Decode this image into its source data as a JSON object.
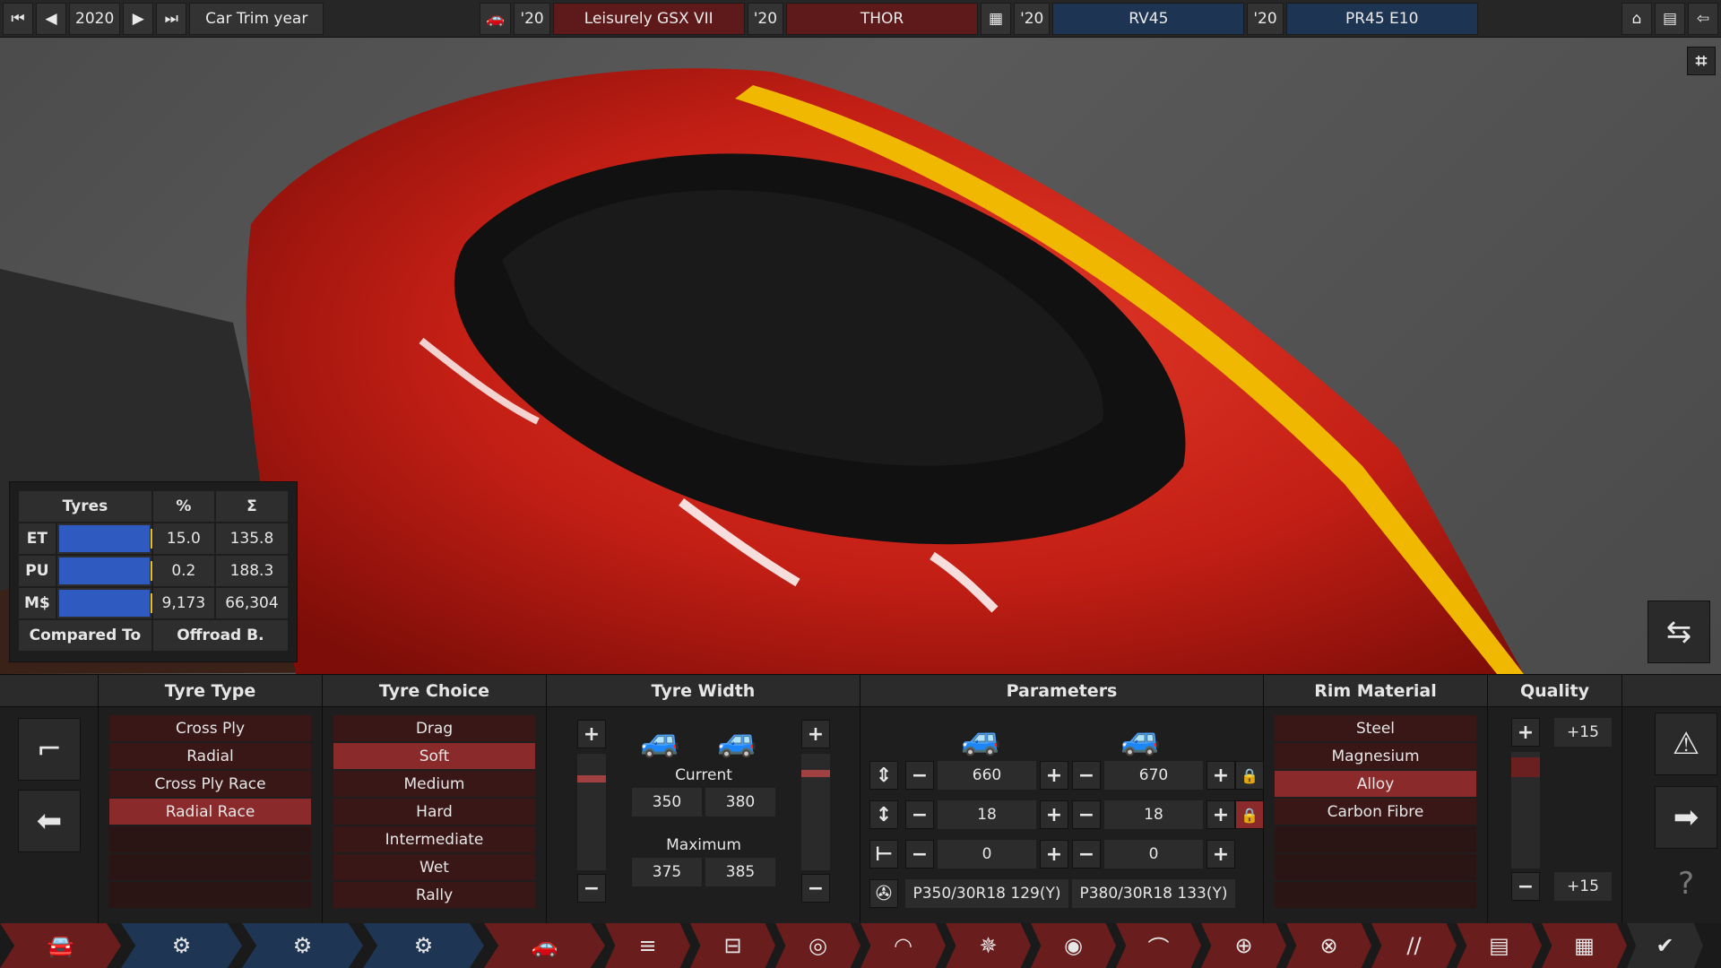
{
  "topbar": {
    "year": "2020",
    "trim_label": "Car Trim year",
    "model": {
      "year": "'20",
      "name": "Leisurely GSX VII"
    },
    "trim": {
      "year": "'20",
      "name": "THOR"
    },
    "engine_family": {
      "year": "'20",
      "name": "RV45"
    },
    "engine_variant": {
      "year": "'20",
      "name": "PR45 E10"
    }
  },
  "stats_card": {
    "headers": [
      "Tyres",
      "%",
      "Σ"
    ],
    "rows": [
      {
        "label": "ET",
        "pct": "15.0",
        "sum": "135.8"
      },
      {
        "label": "PU",
        "pct": "0.2",
        "sum": "188.3"
      },
      {
        "label": "M$",
        "pct": "9,173",
        "sum": "66,304"
      }
    ],
    "compared_to_label": "Compared To",
    "compared_to_value": "Offroad B."
  },
  "panel": {
    "tyre_type": {
      "title": "Tyre Type",
      "items": [
        "Cross Ply",
        "Radial",
        "Cross Ply Race",
        "Radial Race"
      ],
      "selected": "Radial Race"
    },
    "tyre_choice": {
      "title": "Tyre Choice",
      "items": [
        "Drag",
        "Soft",
        "Medium",
        "Hard",
        "Intermediate",
        "Wet",
        "Rally"
      ],
      "selected": "Soft"
    },
    "tyre_width": {
      "title": "Tyre Width",
      "current_label": "Current",
      "current_front": "350",
      "current_rear": "380",
      "maximum_label": "Maximum",
      "maximum_front": "375",
      "maximum_rear": "385"
    },
    "parameters": {
      "title": "Parameters",
      "rows": [
        {
          "front": "660",
          "rear": "670"
        },
        {
          "front": "18",
          "rear": "18"
        },
        {
          "front": "0",
          "rear": "0"
        }
      ],
      "tyre_code_front": "P350/30R18 129(Y)",
      "tyre_code_rear": "P380/30R18 133(Y)"
    },
    "rim_material": {
      "title": "Rim Material",
      "items": [
        "Steel",
        "Magnesium",
        "Alloy",
        "Carbon Fibre"
      ],
      "selected": "Alloy"
    },
    "quality": {
      "title": "Quality",
      "top_value": "+15",
      "bottom_value": "+15"
    }
  },
  "colors": {
    "accent_red": "#8a2a2a",
    "accent_blue": "#2f5bc0",
    "yellow_stripe": "#f0b800"
  }
}
